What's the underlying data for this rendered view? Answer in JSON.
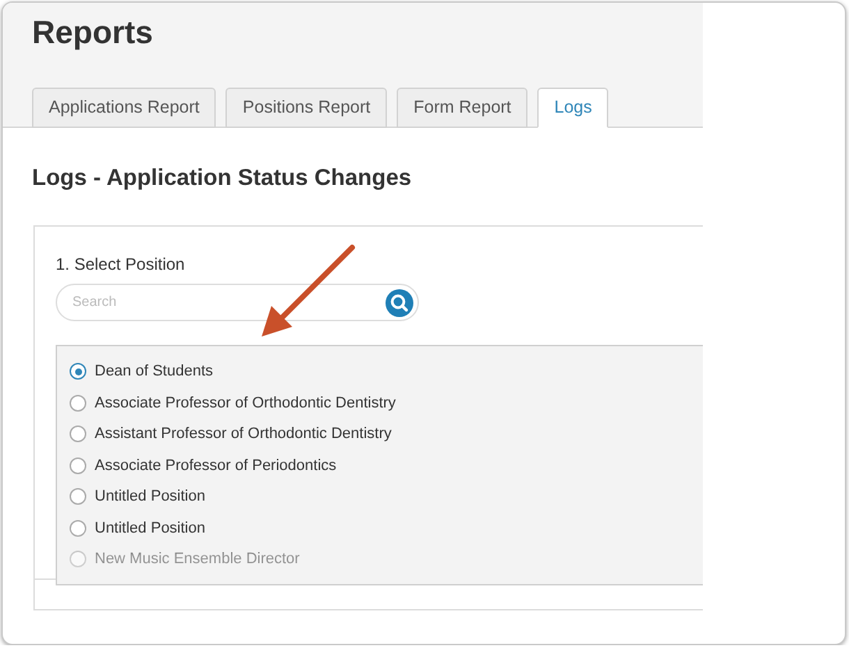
{
  "page": {
    "title": "Reports"
  },
  "tabs": [
    {
      "label": "Applications Report",
      "selected": false
    },
    {
      "label": "Positions Report",
      "selected": false
    },
    {
      "label": "Form Report",
      "selected": false
    },
    {
      "label": "Logs",
      "selected": true
    }
  ],
  "section": {
    "heading": "Logs - Application Status Changes"
  },
  "position_picker": {
    "label": "1. Select Position",
    "search": {
      "placeholder": "Search"
    },
    "options": [
      {
        "label": "Dean of Students",
        "selected": true
      },
      {
        "label": "Associate Professor of Orthodontic Dentistry",
        "selected": false
      },
      {
        "label": "Assistant Professor of Orthodontic Dentistry",
        "selected": false
      },
      {
        "label": "Associate Professor of Periodontics",
        "selected": false
      },
      {
        "label": "Untitled Position",
        "selected": false
      },
      {
        "label": "Untitled Position",
        "selected": false
      },
      {
        "label": "New Music Ensemble Director",
        "selected": false
      }
    ]
  }
}
